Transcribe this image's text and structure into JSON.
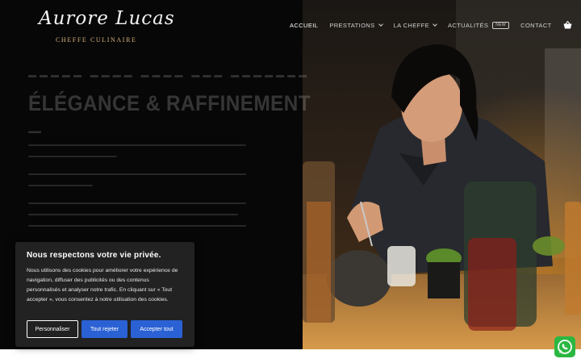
{
  "header": {
    "logo_script": "Aurore Lucas",
    "logo_subtitle": "CHEFFE CULINAIRE",
    "nav": {
      "accueil": "ACCUEIL",
      "prestations": "PRESTATIONS",
      "la_cheffe": "LA CHEFFE",
      "actualites": "ACTUALITÉS",
      "actualites_badge": "NEW",
      "contact": "CONTACT"
    },
    "cart_icon": "basket-icon"
  },
  "hero": {
    "title": "ÉLÉGANCE & RAFFINEMENT"
  },
  "cookie_banner": {
    "title": "Nous respectons votre vie privée.",
    "text": "Nous utilisons des cookies pour améliorer votre expérience de navigation, diffuser des publicités ou des contenus personnalisés et analyser notre trafic. En cliquant sur « Tout accepter », vous consentez à notre utilisation des cookies.",
    "customize_label": "Personnaliser",
    "reject_label": "Tout rejeter",
    "accept_label": "Accepter tout"
  },
  "colors": {
    "accent_gold": "#d6b47a",
    "button_blue": "#2a61d4",
    "whatsapp_green": "#2bb741"
  },
  "floating": {
    "whatsapp_icon": "whatsapp-icon"
  }
}
